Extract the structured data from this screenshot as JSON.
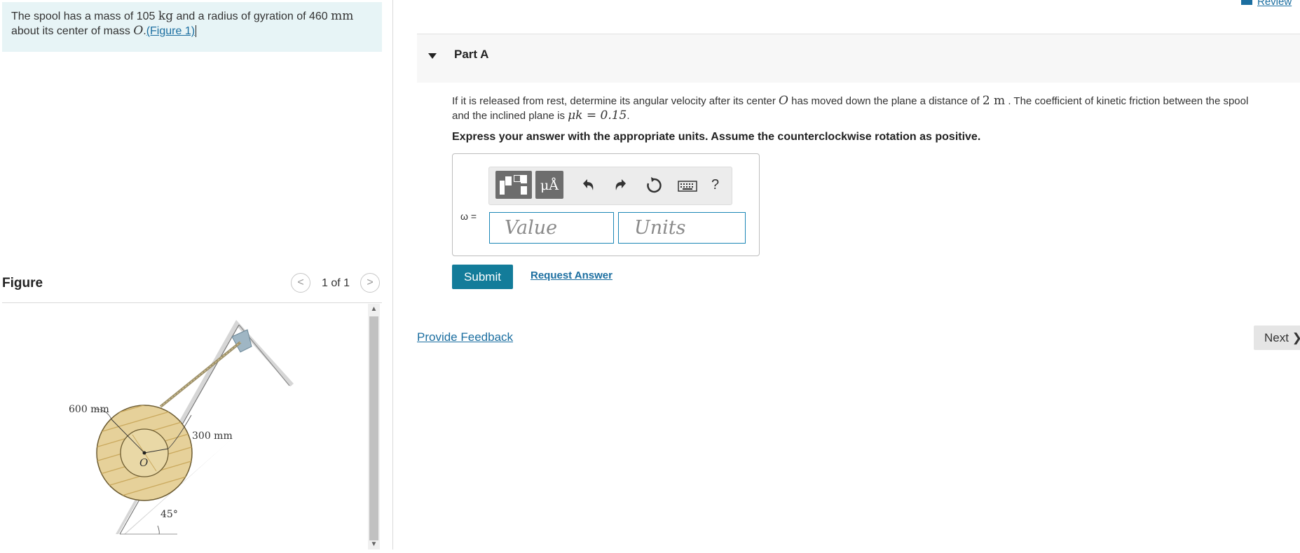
{
  "problem": {
    "text_part1": "The spool has a mass of 105 ",
    "mass_unit": "kg",
    "text_part2": " and a radius of gyration of 460 ",
    "length_unit": "mm",
    "text_part3": "about its center of mass ",
    "center": "O",
    "period": ".",
    "figure_link": "(Figure 1)"
  },
  "figure_panel": {
    "title": "Figure",
    "counter": "1 of 1",
    "prev_icon": "chevron-left-icon",
    "next_icon": "chevron-right-icon",
    "labels": {
      "outer_radius": "600 mm",
      "inner_radius": "300 mm",
      "center": "O",
      "angle": "45°"
    }
  },
  "header": {
    "review_label": "Review"
  },
  "part": {
    "title": "Part A",
    "question_part1": "If it is released from rest, determine its angular velocity after its center ",
    "question_center": "O",
    "question_part2": " has moved down the plane a distance of ",
    "distance": "2 m",
    "question_part3": " . The coefficient of kinetic friction between the spool",
    "question_line2": "and the inclined plane is ",
    "mu_expr": "μk = 0.15",
    "question_end": ".",
    "instruction": "Express your answer with the appropriate units. Assume the counterclockwise rotation as positive."
  },
  "answer": {
    "label": "ω =",
    "value_placeholder": "Value",
    "units_placeholder": "Units",
    "toolbar": {
      "units_button": "μÅ",
      "help": "?"
    }
  },
  "actions": {
    "submit": "Submit",
    "request_answer": "Request Answer",
    "provide_feedback": "Provide Feedback",
    "next": "Next ❯"
  },
  "colors": {
    "accent": "#137c9a",
    "link": "#1b6ea0",
    "problem_bg": "#e7f4f6"
  }
}
